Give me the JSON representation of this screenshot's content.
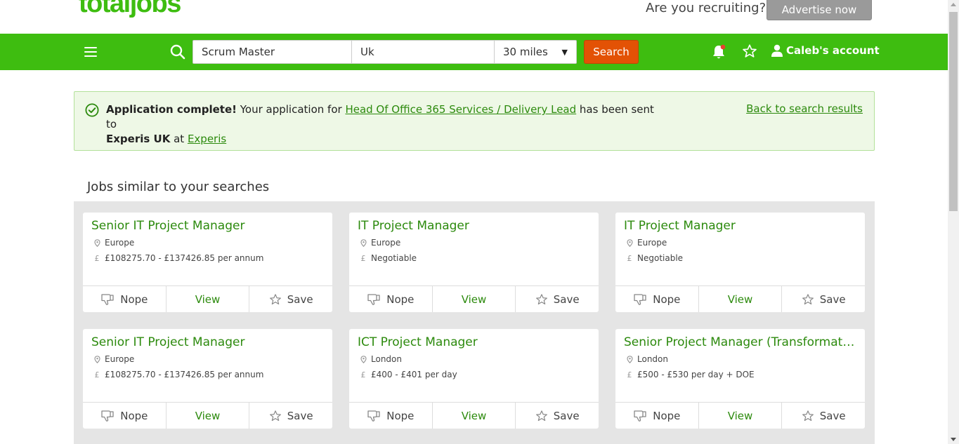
{
  "header": {
    "logo": "totaljobs",
    "recruiting_text": "Are you recruiting?",
    "advertise_label": "Advertise now"
  },
  "nav": {
    "search_what": "Scrum Master",
    "search_where": "Uk",
    "radius": "30 miles",
    "search_label": "Search",
    "account_label": "Caleb's account"
  },
  "alert": {
    "title": "Application complete!",
    "text1": " Your application for ",
    "job_link": "Head Of Office 365 Services / Delivery Lead",
    "text2": " has been sent to",
    "company": "Experis UK",
    "text3": " at ",
    "company_link": "Experis",
    "back_link": "Back to search results"
  },
  "section": {
    "title": "Jobs similar to your searches"
  },
  "jobs": [
    {
      "title": "Senior IT Project Manager",
      "location": "Europe",
      "salary": "£108275.70 - £137426.85 per annum"
    },
    {
      "title": "IT Project Manager",
      "location": "Europe",
      "salary": "Negotiable"
    },
    {
      "title": "IT Project Manager",
      "location": "Europe",
      "salary": "Negotiable"
    },
    {
      "title": "Senior IT Project Manager",
      "location": "Europe",
      "salary": "£108275.70 - £137426.85 per annum"
    },
    {
      "title": "ICT Project Manager",
      "location": "London",
      "salary": "£400 - £401 per day"
    },
    {
      "title": "Senior Project Manager (Transformation)",
      "location": "London",
      "salary": "£500 - £530 per day + DOE"
    }
  ],
  "card_actions": {
    "nope": "Nope",
    "view": "View",
    "save": "Save"
  },
  "colors": {
    "brand_green": "#3ebd10",
    "link_green": "#2c8a0d",
    "search_orange": "#e35205"
  }
}
